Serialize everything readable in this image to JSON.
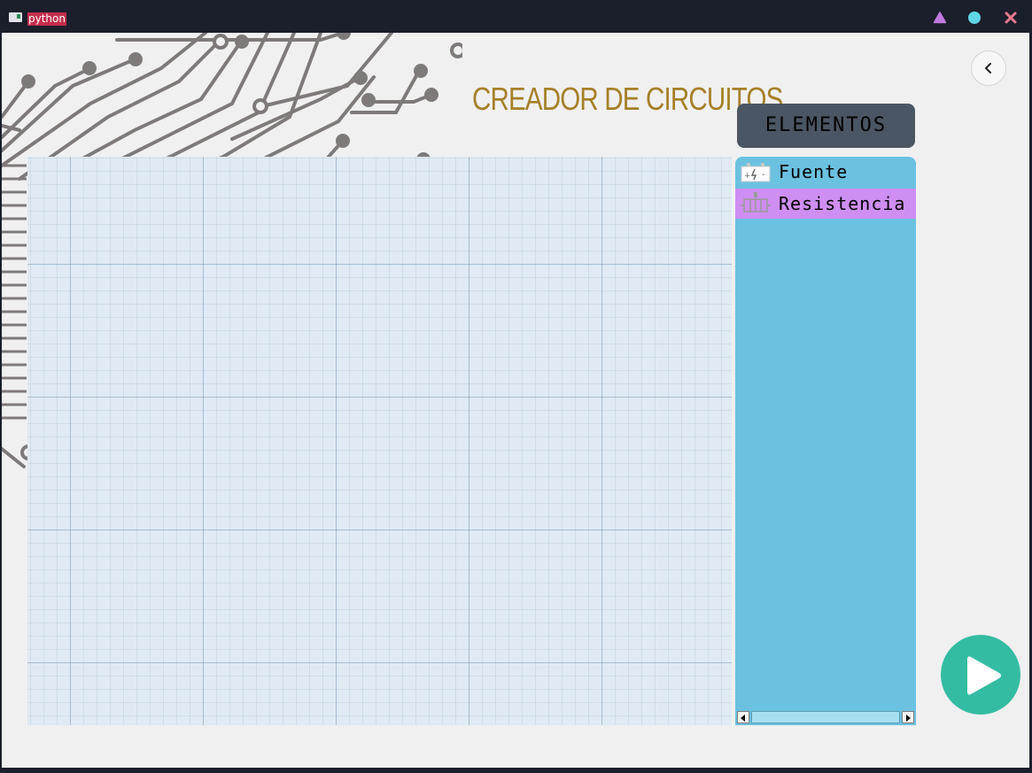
{
  "window": {
    "title": "python",
    "controls": [
      {
        "name": "minimize",
        "icon": "triangle-icon",
        "color": "#c279e0"
      },
      {
        "name": "maximize",
        "icon": "circle-icon",
        "color": "#5fd6e8"
      },
      {
        "name": "close",
        "icon": "x-icon",
        "color": "#e8788e"
      }
    ]
  },
  "app": {
    "title": "CREADOR DE CIRCUITOS",
    "title_color": "#a67f27"
  },
  "navigation": {
    "back_icon": "chevron-left-icon"
  },
  "elements_panel": {
    "header": "ELEMENTOS",
    "items": [
      {
        "label": "Fuente",
        "icon": "battery-icon",
        "selected": false
      },
      {
        "label": "Resistencia",
        "icon": "resistor-icon",
        "selected": true
      }
    ],
    "background": "#6bc1e0",
    "selected_color": "#cf8ef2"
  },
  "canvas": {
    "background": "#dfeaf4"
  },
  "run": {
    "icon": "play-icon",
    "color": "#34bca3"
  }
}
